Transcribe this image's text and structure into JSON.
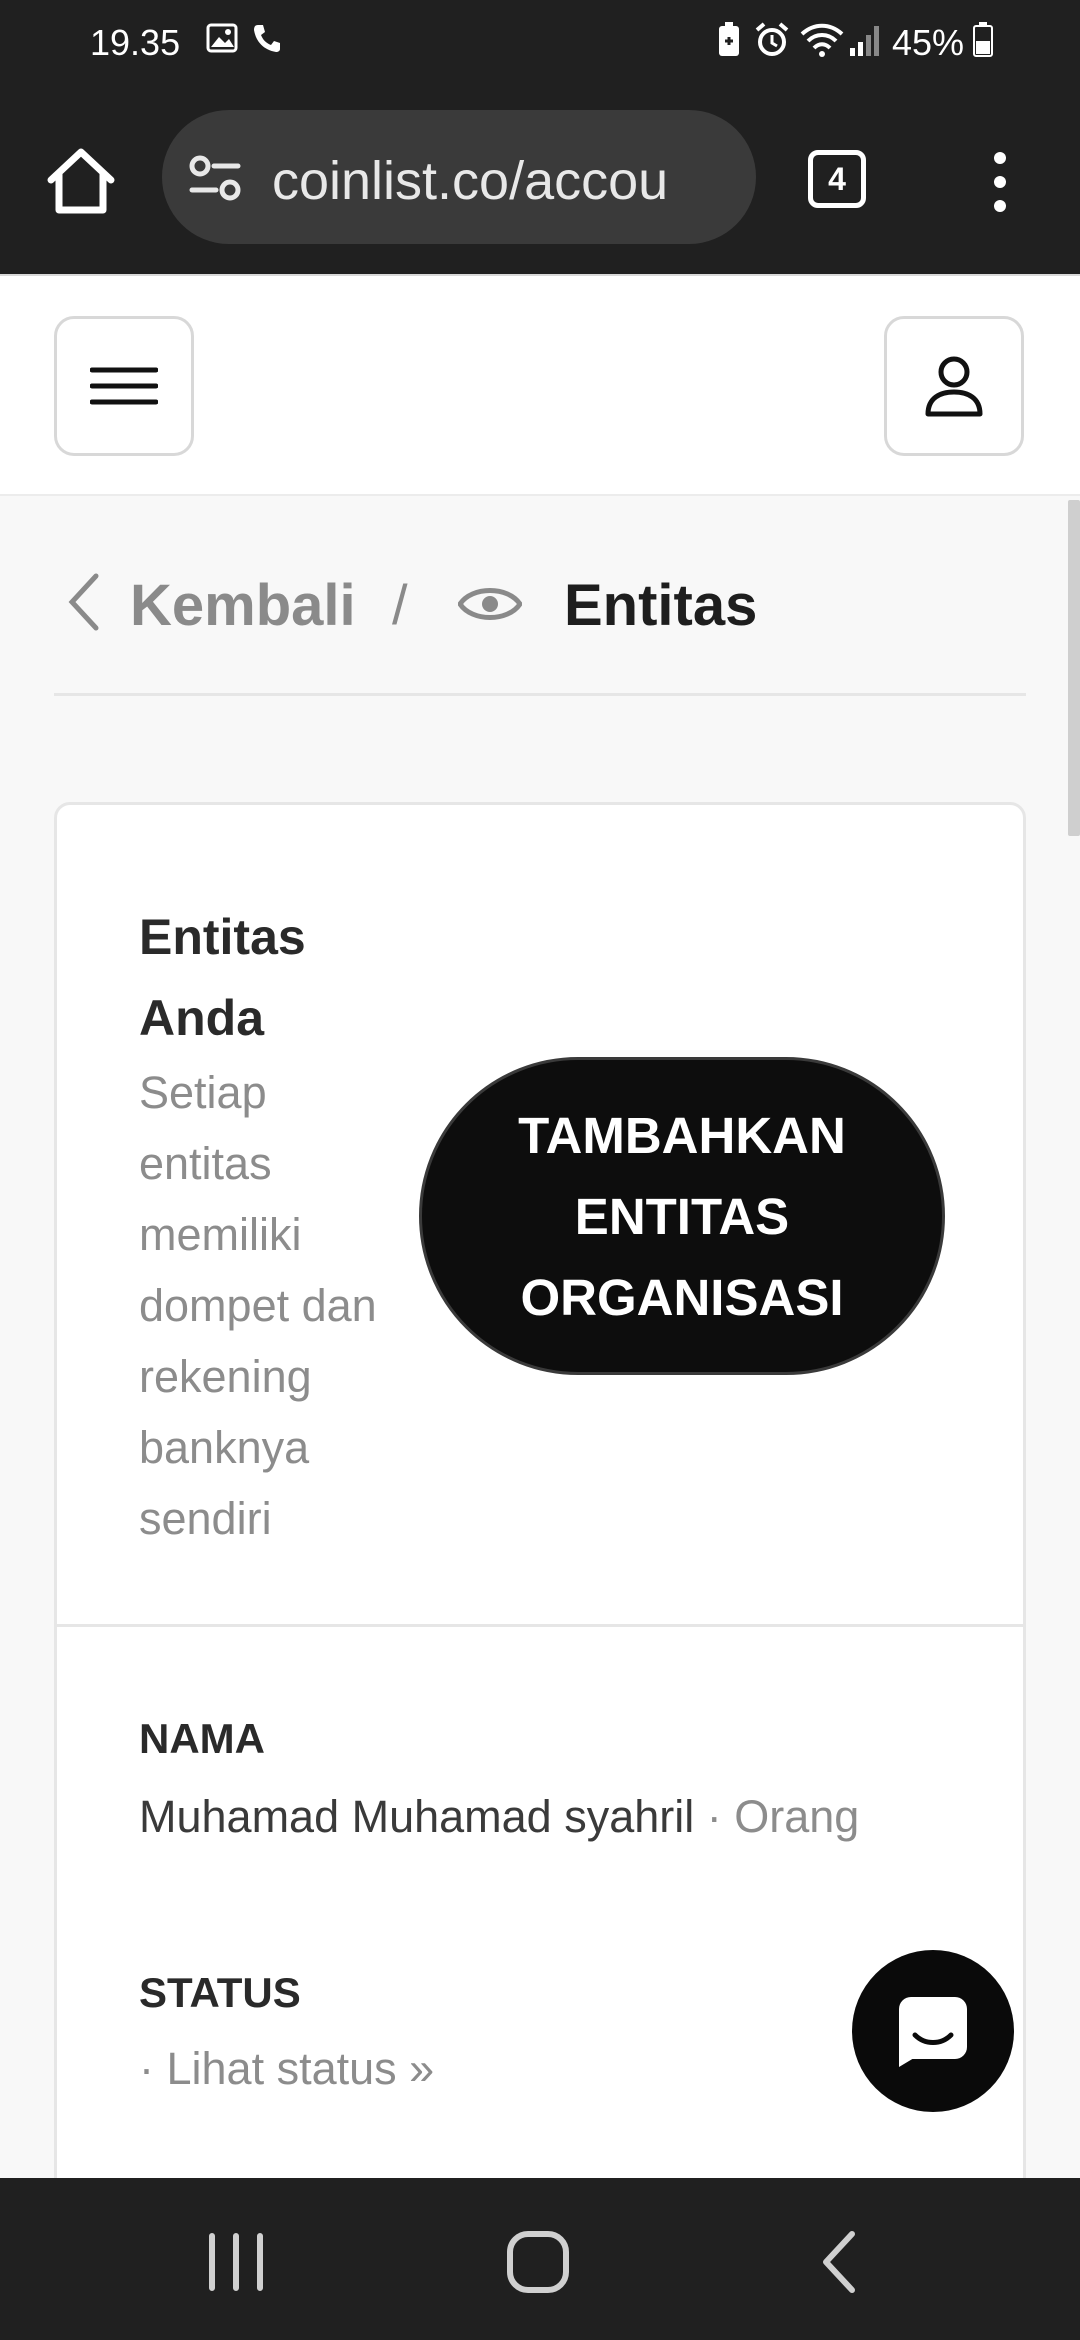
{
  "status_bar": {
    "time": "19.35",
    "battery_percent": "45%"
  },
  "browser": {
    "url": "coinlist.co/accou",
    "tab_count": "4"
  },
  "breadcrumb": {
    "back_label": "Kembali",
    "separator": "/",
    "current_label": "Entitas"
  },
  "entities_card": {
    "title": "Entitas Anda",
    "description": "Setiap entitas memiliki dompet dan rekening banknya sendiri",
    "add_button_label": "TAMBAHKAN ENTITAS ORGANISASI"
  },
  "name_field": {
    "label": "NAMA",
    "value": "Muhamad Muhamad syahril",
    "dot": " · ",
    "type": "Orang"
  },
  "status_field": {
    "label": "STATUS",
    "link": "· Lihat status »"
  },
  "colors": {
    "system_bar": "#202020",
    "primary_button": "#0d0d0d",
    "muted_text": "#8c8c8c"
  }
}
